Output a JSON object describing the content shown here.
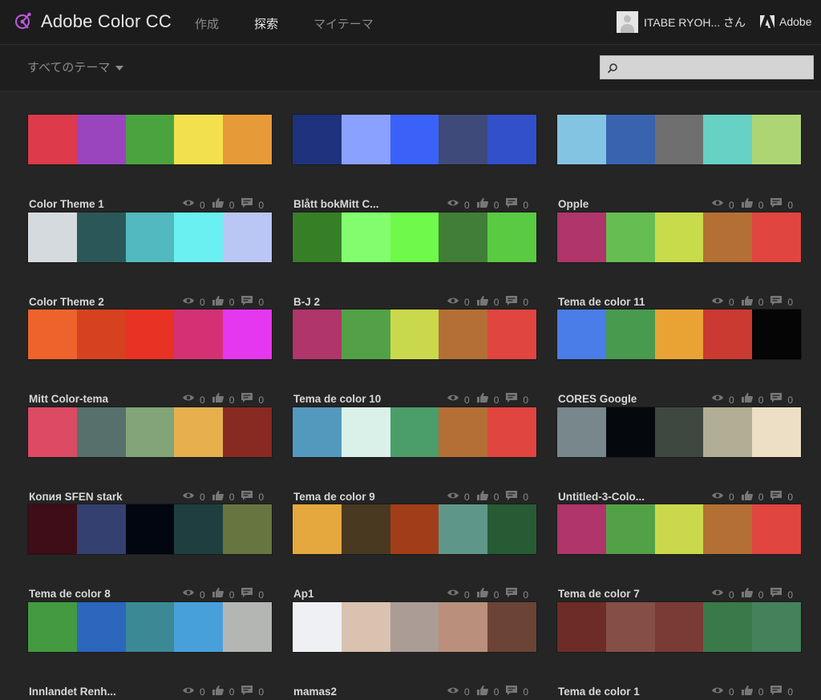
{
  "header": {
    "app_title": "Adobe Color CC",
    "nav": [
      {
        "label": "作成",
        "active": false
      },
      {
        "label": "探索",
        "active": true
      },
      {
        "label": "マイテーマ",
        "active": false
      }
    ],
    "user_name": "ITABE RYOH... さん",
    "adobe_label": "Adobe",
    "logo_color": "#c159e0"
  },
  "toolbar": {
    "filter_label": "すべてのテーマ",
    "search_value": ""
  },
  "themes": [
    {
      "name": "Color Theme 1",
      "colors": [
        "#DD3A4B",
        "#9A44BE",
        "#4BA340",
        "#F2E14C",
        "#E79A38"
      ],
      "views": "0",
      "likes": "0",
      "comments": "0"
    },
    {
      "name": "Blått bokMitt C...",
      "colors": [
        "#1F327D",
        "#8BA1FF",
        "#3B62F8",
        "#3E4A79",
        "#3250CA"
      ],
      "views": "0",
      "likes": "0",
      "comments": "0"
    },
    {
      "name": "Opple",
      "colors": [
        "#84C4E3",
        "#3963AF",
        "#6F6F6F",
        "#66D1C4",
        "#AED573"
      ],
      "views": "0",
      "likes": "0",
      "comments": "0"
    },
    {
      "name": "Color Theme 2",
      "colors": [
        "#D5DADE",
        "#2C5758",
        "#51B9BF",
        "#6AF0F0",
        "#BAC6F4"
      ],
      "views": "0",
      "likes": "0",
      "comments": "0"
    },
    {
      "name": "B-J 2",
      "colors": [
        "#367F27",
        "#82FD6E",
        "#6FF94A",
        "#417E37",
        "#5ACA43"
      ],
      "views": "0",
      "likes": "0",
      "comments": "0"
    },
    {
      "name": "Tema de color 11",
      "colors": [
        "#B0356A",
        "#66BE52",
        "#C7DB4B",
        "#B46F35",
        "#E04540"
      ],
      "views": "0",
      "likes": "0",
      "comments": "0"
    },
    {
      "name": "Mitt Color-tema",
      "colors": [
        "#EE632B",
        "#D6411F",
        "#E83223",
        "#D43175",
        "#E637F0"
      ],
      "views": "0",
      "likes": "0",
      "comments": "0"
    },
    {
      "name": "Tema de color 10",
      "colors": [
        "#B0356A",
        "#53A147",
        "#CAD94B",
        "#B46F35",
        "#E04540"
      ],
      "views": "0",
      "likes": "0",
      "comments": "0"
    },
    {
      "name": "CORES Google",
      "colors": [
        "#4B7DE8",
        "#489A4E",
        "#E9A334",
        "#CA3A31",
        "#050505"
      ],
      "views": "0",
      "likes": "0",
      "comments": "0"
    },
    {
      "name": "Копия SFEN stark",
      "colors": [
        "#DD4A63",
        "#58706B",
        "#81A578",
        "#E7B04D",
        "#882922"
      ],
      "views": "0",
      "likes": "0",
      "comments": "0"
    },
    {
      "name": "Tema de color 9",
      "colors": [
        "#5399BE",
        "#DAF1EA",
        "#4B9D6A",
        "#B46F35",
        "#E04540"
      ],
      "views": "0",
      "likes": "0",
      "comments": "0"
    },
    {
      "name": "Untitled-3-Colo...",
      "colors": [
        "#77878C",
        "#05080D",
        "#3E4840",
        "#B2AE95",
        "#EDDFC6"
      ],
      "views": "0",
      "likes": "0",
      "comments": "0"
    },
    {
      "name": "Tema de color 8",
      "colors": [
        "#3E0D17",
        "#334070",
        "#020610",
        "#1E3E3F",
        "#677641"
      ],
      "views": "0",
      "likes": "0",
      "comments": "0"
    },
    {
      "name": "Ap1",
      "colors": [
        "#E5A83E",
        "#483920",
        "#A13E19",
        "#5E978A",
        "#275B34"
      ],
      "views": "0",
      "likes": "0",
      "comments": "0"
    },
    {
      "name": "Tema de color 7",
      "colors": [
        "#B0356A",
        "#53A147",
        "#CAD94B",
        "#B46F35",
        "#E04540"
      ],
      "views": "0",
      "likes": "0",
      "comments": "0"
    },
    {
      "name": "Innlandet Renh...",
      "colors": [
        "#449A40",
        "#2C66BD",
        "#3A8994",
        "#48A0DA",
        "#B4B6B4"
      ],
      "views": "0",
      "likes": "0",
      "comments": "0"
    },
    {
      "name": "mamas2",
      "colors": [
        "#EFF0F4",
        "#DAC2B0",
        "#AB9C95",
        "#BA8F7B",
        "#6B4337"
      ],
      "views": "0",
      "likes": "0",
      "comments": "0"
    },
    {
      "name": "Tema de color 1",
      "colors": [
        "#6D2D26",
        "#864F46",
        "#7A3B35",
        "#3A7A48",
        "#45815A"
      ],
      "views": "0",
      "likes": "0",
      "comments": "0"
    }
  ]
}
